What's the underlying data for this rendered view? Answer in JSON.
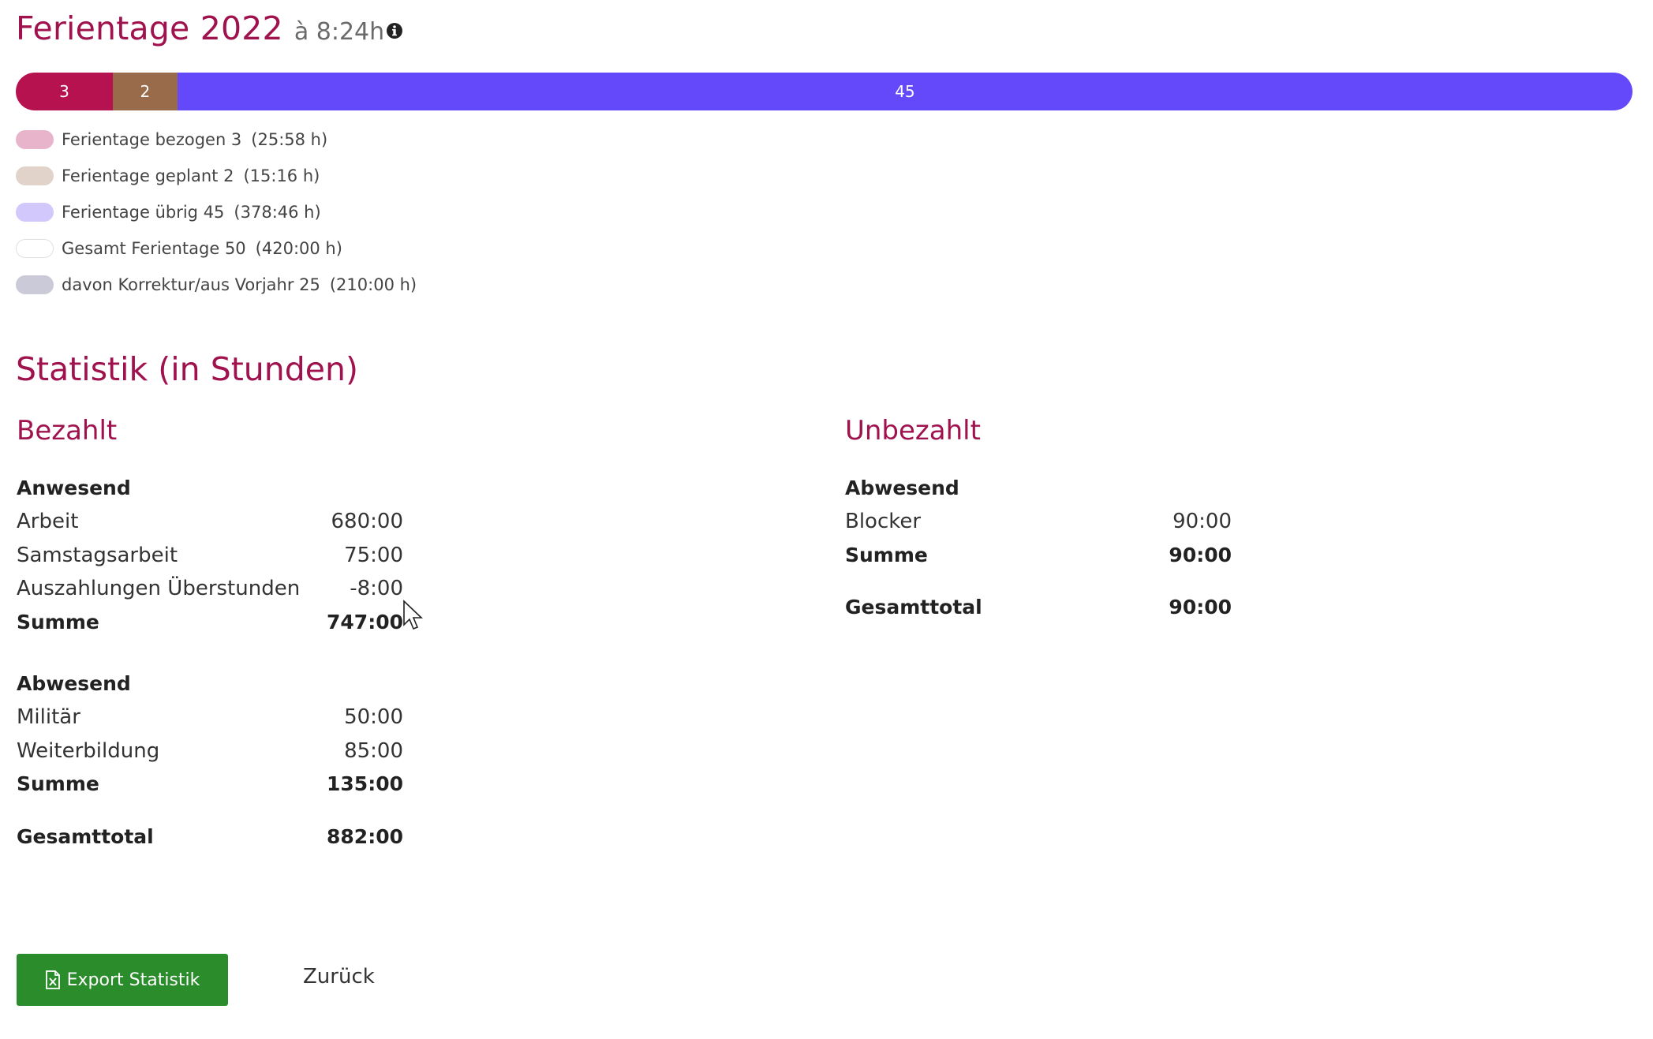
{
  "header": {
    "title": "Ferientage 2022",
    "subtitle": "à 8:24h",
    "info_icon": "info-circle-icon"
  },
  "vacation_bar": {
    "segments": [
      {
        "label": "3",
        "value": 3,
        "color": "#b5124f"
      },
      {
        "label": "2",
        "value": 2,
        "color": "#9a6b4a"
      },
      {
        "label": "45",
        "value": 45,
        "color": "#6449fa"
      }
    ]
  },
  "legend": [
    {
      "label": "Ferientage bezogen 3",
      "hours": "(25:58 h)",
      "color": "#e8b4cb"
    },
    {
      "label": "Ferientage geplant 2",
      "hours": "(15:16 h)",
      "color": "#e2d3ca"
    },
    {
      "label": "Ferientage übrig 45",
      "hours": "(378:46 h)",
      "color": "#d2c8fc"
    },
    {
      "label": "Gesamt Ferientage 50",
      "hours": "(420:00 h)",
      "color": "#ffffff"
    },
    {
      "label": "davon Korrektur/aus Vorjahr 25",
      "hours": "(210:00 h)",
      "color": "#cbcad8"
    }
  ],
  "statistics": {
    "title": "Statistik (in Stunden)",
    "paid": {
      "title": "Bezahlt",
      "present": {
        "title": "Anwesend",
        "rows": [
          {
            "label": "Arbeit",
            "value": "680:00"
          },
          {
            "label": "Samstagsarbeit",
            "value": "75:00"
          },
          {
            "label": "Auszahlungen Überstunden",
            "value": "-8:00"
          }
        ],
        "sum_label": "Summe",
        "sum_value": "747:00"
      },
      "absent": {
        "title": "Abwesend",
        "rows": [
          {
            "label": "Militär",
            "value": "50:00"
          },
          {
            "label": "Weiterbildung",
            "value": "85:00"
          }
        ],
        "sum_label": "Summe",
        "sum_value": "135:00"
      },
      "total_label": "Gesamttotal",
      "total_value": "882:00"
    },
    "unpaid": {
      "title": "Unbezahlt",
      "absent": {
        "title": "Abwesend",
        "rows": [
          {
            "label": "Blocker",
            "value": "90:00"
          }
        ],
        "sum_label": "Summe",
        "sum_value": "90:00"
      },
      "total_label": "Gesamttotal",
      "total_value": "90:00"
    }
  },
  "actions": {
    "export_label": "Export Statistik",
    "export_icon": "file-excel-icon",
    "back_label": "Zurück"
  }
}
